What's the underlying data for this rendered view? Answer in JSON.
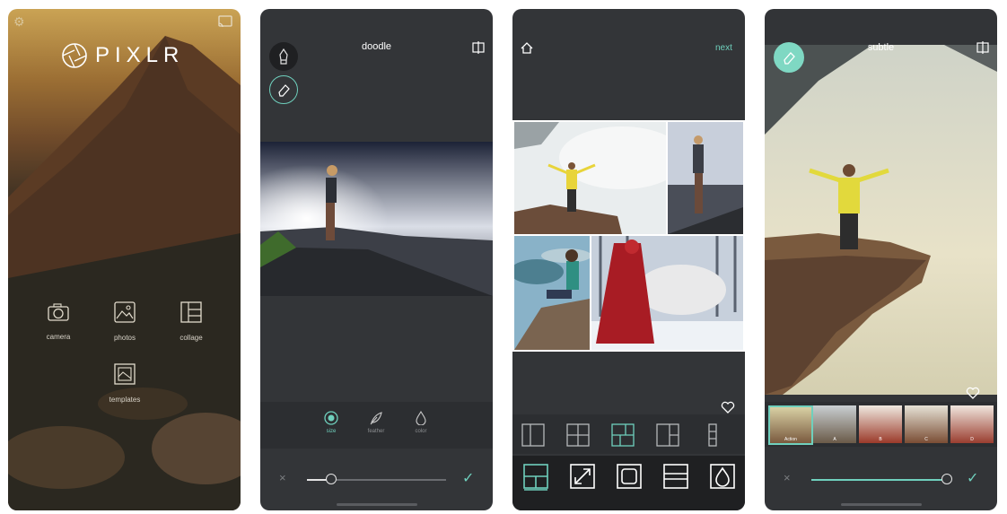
{
  "screen1": {
    "logo": "PIXLR",
    "menu": [
      {
        "label": "camera",
        "icon": "camera-icon"
      },
      {
        "label": "photos",
        "icon": "photos-icon"
      },
      {
        "label": "collage",
        "icon": "collage-icon"
      },
      {
        "label": "templates",
        "icon": "templates-icon"
      }
    ]
  },
  "screen2": {
    "title": "doodle",
    "tools": [
      {
        "label": "size",
        "icon": "size-icon"
      },
      {
        "label": "feather",
        "icon": "feather-icon"
      },
      {
        "label": "color",
        "icon": "color-drop-icon"
      }
    ],
    "slider_value": 0.14
  },
  "screen3": {
    "next_label": "next",
    "layouts": [
      "layout-1",
      "layout-2",
      "layout-3",
      "layout-4",
      "layout-5"
    ],
    "options": [
      "layout-option",
      "resize-option",
      "border-option",
      "spacing-option",
      "background-option"
    ]
  },
  "screen4": {
    "title": "subtle",
    "filters": [
      "Action",
      "A",
      "B",
      "C",
      "D"
    ],
    "slider_value": 0.96
  },
  "colors": {
    "accent": "#6fd0bd",
    "panel": "#333538",
    "toolbar": "#2c2e31"
  }
}
